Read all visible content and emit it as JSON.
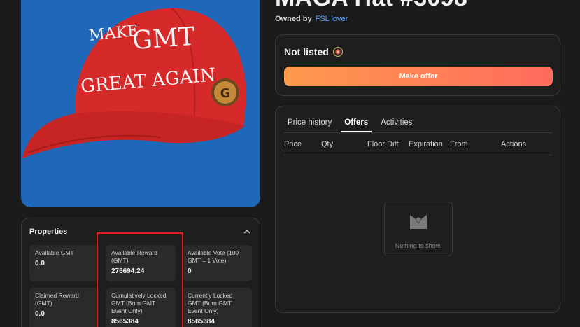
{
  "nft": {
    "title": "MAGA Hat #3098",
    "image_caption": "",
    "hat_text_line1": "MAKE",
    "hat_text_line2": "GMT",
    "hat_text_line3": "GREAT AGAIN",
    "colors": {
      "background": "#1f67b8",
      "hat": "#d62a2a",
      "coin": "#c48a3a"
    }
  },
  "owner": {
    "label": "Owned by",
    "name": "FSL lover"
  },
  "listing": {
    "status": "Not listed",
    "button": "Make offer"
  },
  "offers_panel": {
    "tabs": [
      {
        "label": "Price history",
        "active": false
      },
      {
        "label": "Offers",
        "active": true
      },
      {
        "label": "Activities",
        "active": false
      }
    ],
    "columns": [
      "Price",
      "Qty",
      "Floor Diff",
      "Expiration",
      "From",
      "Actions"
    ],
    "empty_text": "Nothing to show."
  },
  "properties": {
    "title": "Properties",
    "items": [
      {
        "label": "Available GMT",
        "value": "0.0"
      },
      {
        "label": "Available Reward (GMT)",
        "value": "276694.24"
      },
      {
        "label": "Available Vote (100 GMT = 1 Vote)",
        "value": "0"
      },
      {
        "label": "Claimed Reward (GMT)",
        "value": "0.0"
      },
      {
        "label": "Cumulatively Locked GMT (Burn GMT Event Only)",
        "value": "8565384"
      },
      {
        "label": "Currently Locked GMT (Burn GMT Event Only)",
        "value": "8565384"
      }
    ]
  }
}
